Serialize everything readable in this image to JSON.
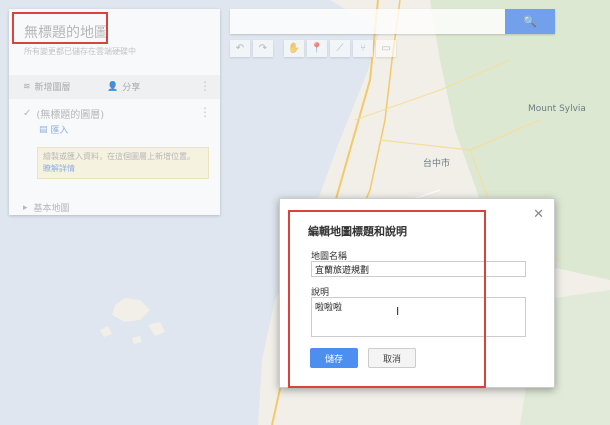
{
  "panel": {
    "title": "無標題的地圖",
    "subtitle": "所有變更都已儲存在雲端硬碟中",
    "add_layer": "新增圖層",
    "share": "分享",
    "layer_name": "(無標題的圖層)",
    "import": "匯入",
    "note_text": "繪製或匯入資料，在這個圖層上新增位置。",
    "note_link": "瞭解詳情",
    "basemap": "基本地圖"
  },
  "search": {
    "placeholder": ""
  },
  "map": {
    "label_city": "台中市",
    "label_mountain": "Mount Sylvia"
  },
  "dialog": {
    "title": "編輯地圖標題和說明",
    "name_label": "地圖名稱",
    "name_value": "宜蘭旅遊規劃",
    "desc_label": "說明",
    "desc_value": "啦啦啦",
    "save": "儲存",
    "cancel": "取消"
  },
  "colors": {
    "accent": "#4d8ff0",
    "highlight": "#d8443b"
  }
}
